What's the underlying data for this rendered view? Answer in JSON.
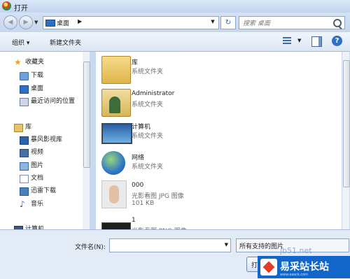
{
  "window": {
    "title": "打开"
  },
  "address": {
    "location": "桌面",
    "search_placeholder": "搜索 桌面"
  },
  "toolbar": {
    "organize": "组织 ▾",
    "new_folder": "新建文件夹"
  },
  "sidebar": {
    "items": [
      {
        "label": "收藏夹",
        "icon": "star-icon"
      },
      {
        "label": "下载",
        "icon": "downloads-folder-icon"
      },
      {
        "label": "桌面",
        "icon": "desktop-icon"
      },
      {
        "label": "最近访问的位置",
        "icon": "recent-places-icon"
      },
      {
        "label": "库",
        "icon": "library-icon"
      },
      {
        "label": "暴风影视库",
        "icon": "video-library-icon"
      },
      {
        "label": "视频",
        "icon": "videos-icon"
      },
      {
        "label": "图片",
        "icon": "pictures-icon"
      },
      {
        "label": "文档",
        "icon": "documents-icon"
      },
      {
        "label": "迅雷下载",
        "icon": "thunder-download-icon"
      },
      {
        "label": "音乐",
        "icon": "music-icon"
      },
      {
        "label": "计算机",
        "icon": "computer-icon"
      }
    ]
  },
  "files": [
    {
      "name": "库",
      "type": "系统文件夹",
      "icon": "library-folder-icon"
    },
    {
      "name": "Administrator",
      "type": "系统文件夹",
      "icon": "user-folder-icon"
    },
    {
      "name": "计算机",
      "type": "系统文件夹",
      "icon": "computer-icon"
    },
    {
      "name": "网络",
      "type": "系统文件夹",
      "icon": "network-icon"
    },
    {
      "name": "000",
      "type": "光影看图 JPG 图像",
      "size": "101 KB",
      "icon": "image-thumbnail-icon"
    },
    {
      "name": "1",
      "type": "光影看图 PNG 图像",
      "icon": "image-thumbnail-icon"
    }
  ],
  "bottom": {
    "filename_label": "文件名(N):",
    "filename_value": "",
    "filetype_value": "所有支持的图片",
    "open_button": "打"
  },
  "watermark": {
    "url": "jb51.net",
    "brand": "易采站长站",
    "sub": "www.easck.com"
  }
}
